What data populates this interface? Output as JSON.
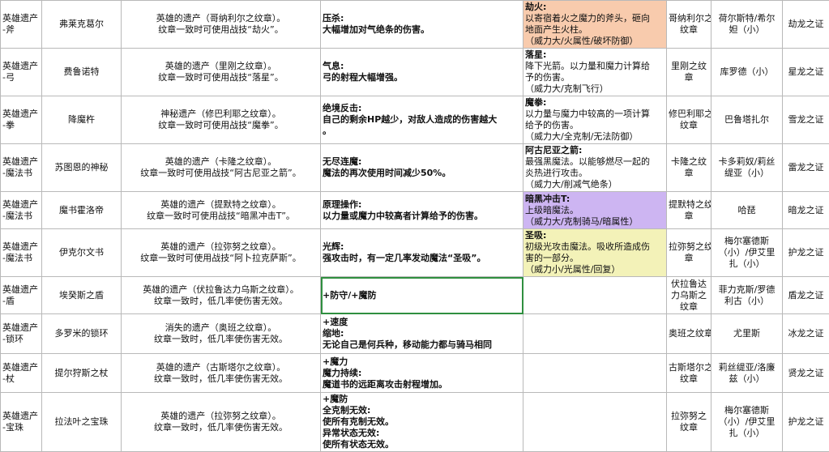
{
  "table": {
    "rows": [
      {
        "type": "英雄遗产\n-斧",
        "name": "弗莱克葛尔",
        "crest": [
          "英雄的遗产（哥纳利尔之纹章）。",
          "纹章一致时可使用战技“劫火”。"
        ],
        "skill": [
          "压杀:",
          "大幅增加对气绝条的伤害。"
        ],
        "combat": [
          "劫火:",
          "以寄宿着火之魔力的斧头，砸向",
          "地面产生火柱。",
          "（威力大/火属性/破坏防御）"
        ],
        "combat_bg": "orange",
        "emblem": "哥纳利尔之\n纹章",
        "char": "荷尔斯特/希尔\n妲（小）",
        "proof": "劫龙之证"
      },
      {
        "type": "英雄遗产\n-弓",
        "name": "费鲁诺特",
        "crest": [
          "英雄的遗产（里刚之纹章）。",
          "纹章一致时可使用战技“落星”。"
        ],
        "skill": [
          "气息:",
          "弓的射程大幅增强。"
        ],
        "combat": [
          "落星:",
          "降下光箭。以力量和魔力计算给",
          "予的伤害。",
          "（威力大/克制飞行）"
        ],
        "combat_bg": "",
        "emblem": "里刚之纹\n章",
        "char": "库罗德（小）",
        "proof": "星龙之证"
      },
      {
        "type": "英雄遗产\n-拳",
        "name": "降魔杵",
        "crest": [
          "神秘遗产（修巴利耶之纹章）。",
          "纹章一致时可使用战技“魔拳”。"
        ],
        "skill": [
          "绝境反击:",
          "自己的剩余HP越少，对敌人造成的伤害越大",
          "。"
        ],
        "combat": [
          "魔拳:",
          "以力量与魔力中较高的一项计算",
          "给予的伤害。",
          "（威力大/全克制/无法防御）"
        ],
        "combat_bg": "",
        "emblem": "修巴利耶之\n纹章",
        "char": "巴鲁塔扎尔",
        "proof": "雪龙之证"
      },
      {
        "type": "英雄遗产\n-魔法书",
        "name": "苏图恩的神秘",
        "crest": [
          "英雄的遗产（卡隆之纹章）。",
          "纹章一致时可使用战技“阿古尼亚之箭”。"
        ],
        "skill": [
          "无尽连魔:",
          "魔法的再次使用时间减少50%。"
        ],
        "combat": [
          "阿古尼亚之箭:",
          "最强黑魔法。以能够燃尽一起的",
          "炎热进行攻击。",
          "（威力大/削减气绝条）"
        ],
        "combat_bg": "",
        "emblem": "卡隆之纹\n章",
        "char": "卡多莉奴/莉丝\n缇亚（小）",
        "proof": "雷龙之证"
      },
      {
        "type": "英雄遗产\n-魔法书",
        "name": "魔书霍洛帝",
        "crest": [
          "英雄的遗产（提默特之纹章）。",
          "纹章一致时可使用战技“暗黑冲击T”。"
        ],
        "skill": [
          "原理操作:",
          "以力量或魔力中较高者计算给予的伤害。"
        ],
        "combat": [
          "暗黑冲击T:",
          "上级暗魔法。",
          "（威力大/克制骑马/暗属性）"
        ],
        "combat_bg": "purple",
        "emblem": "提默特之纹\n章",
        "char": "哈琵",
        "proof": "暗龙之证"
      },
      {
        "type": "英雄遗产\n-魔法书",
        "name": "伊克尔文书",
        "crest": [
          "英雄的遗产（拉弥努之纹章）。",
          "纹章一致时可使用战技“阿卜拉克萨斯”。"
        ],
        "skill": [
          "光辉:",
          "强攻击时，有一定几率发动魔法“圣吸”。"
        ],
        "combat": [
          "圣吸:",
          "初级光攻击魔法。吸收所造成伤",
          "害的一部分。",
          "（威力小/光属性/回复）"
        ],
        "combat_bg": "yellow",
        "emblem": "拉弥努之纹\n章",
        "char": "梅尔塞德斯\n（小）/伊艾里\n扎（小）",
        "proof": "护龙之证"
      },
      {
        "type": "英雄遗产\n-盾",
        "name": "埃癸斯之盾",
        "crest": [
          "英雄的遗产（伏拉鲁达力乌斯之纹章）。",
          "纹章一致时，低几率使伤害无效。"
        ],
        "skill": [
          "+防守/+魔防"
        ],
        "combat": [],
        "combat_bg": "",
        "emblem": "伏拉鲁达\n力乌斯之\n纹章",
        "char": "菲力克斯/罗德\n利古（小）",
        "proof": "盾龙之证"
      },
      {
        "type": "英雄遗产\n-锁环",
        "name": "多罗米的锁环",
        "crest": [
          "消失的遗产（奥班之纹章）。",
          "纹章一致时，低几率使伤害无效。"
        ],
        "skill": [
          "+速度",
          "缩地:",
          "无论自己是何兵种，移动能力都与骑马相同"
        ],
        "combat": [],
        "combat_bg": "",
        "emblem": "奥班之纹章",
        "char": "尤里斯",
        "proof": "冰龙之证"
      },
      {
        "type": "英雄遗产\n-杖",
        "name": "提尔狩斯之杖",
        "crest": [
          "英雄的遗产（古斯塔尔之纹章）。",
          "纹章一致时，低几率使伤害无效。"
        ],
        "skill": [
          "+魔力",
          "魔力持续:",
          "魔道书的远距离攻击射程增加。"
        ],
        "combat": [],
        "combat_bg": "",
        "emblem": "古斯塔尔之\n纹章",
        "char": "莉丝缇亚/洛廉\n兹（小）",
        "proof": "贤龙之证"
      },
      {
        "type": "英雄遗产\n-宝珠",
        "name": "拉法叶之宝珠",
        "crest": [
          "英雄的遗产（拉弥努之纹章）。",
          "纹章一致时，低几率使伤害无效。"
        ],
        "skill": [
          "+魔防",
          "全克制无效:",
          "使所有克制无效。",
          "异常状态无效:",
          "使所有状态无效。"
        ],
        "combat": [],
        "combat_bg": "",
        "emblem": "拉弥努之\n纹章",
        "char": "梅尔塞德斯\n（小）/伊艾里\n扎（小）",
        "proof": "护龙之证"
      }
    ]
  }
}
